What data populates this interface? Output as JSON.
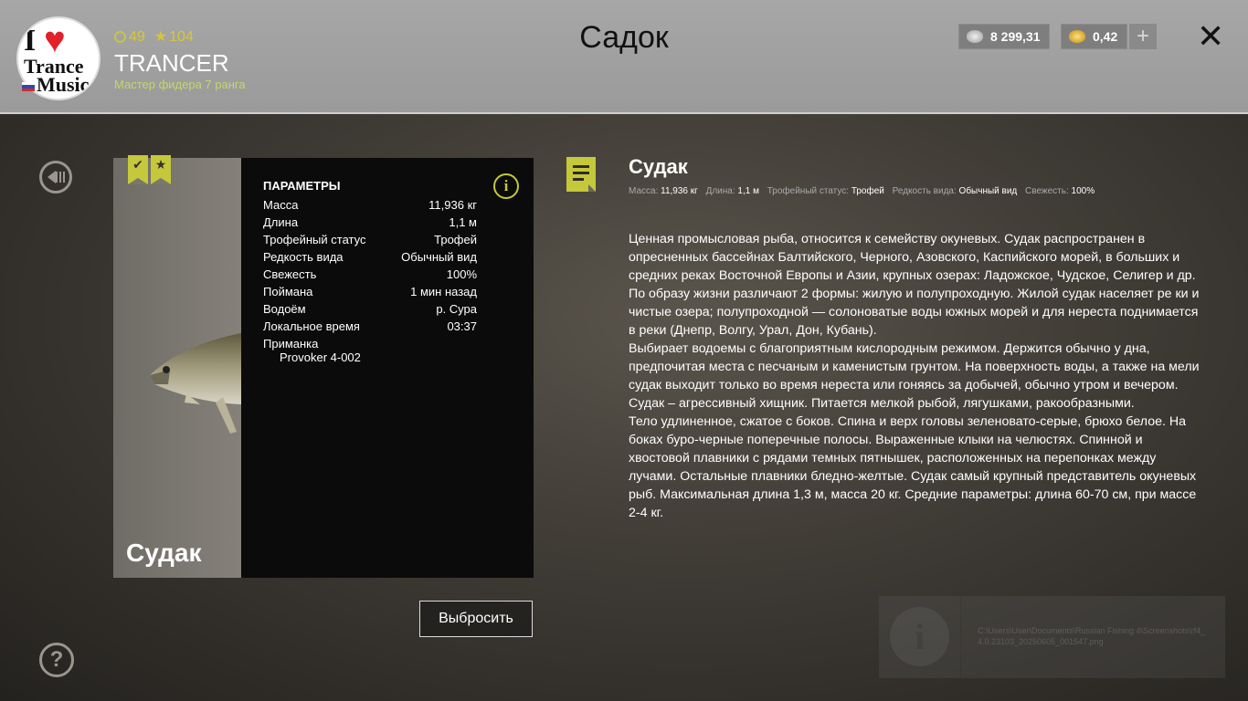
{
  "header": {
    "title": "Садок",
    "level": "49",
    "stars": "104",
    "username": "TRANCER",
    "rank": "Мастер фидера 7 ранга",
    "avatar_text": [
      "I",
      "Trance",
      "Music"
    ],
    "silver": "8 299,31",
    "gold": "0,42",
    "plus_label": "+",
    "close_label": "✕",
    "colors": {
      "silver": "#c9c9c9",
      "gold": "#e4b21e",
      "accent": "#c5c83a"
    }
  },
  "card": {
    "fish_name": "Судак",
    "params_title": "ПАРАМЕТРЫ",
    "params": [
      {
        "label": "Масса",
        "value": "11,936 кг"
      },
      {
        "label": "Длина",
        "value": "1,1 м"
      },
      {
        "label": "Трофейный статус",
        "value": "Трофей"
      },
      {
        "label": "Редкость вида",
        "value": "Обычный вид"
      },
      {
        "label": "Свежесть",
        "value": "100%"
      },
      {
        "label": "Поймана",
        "value": "1 мин назад"
      },
      {
        "label": "Водоём",
        "value": "р. Сура"
      },
      {
        "label": "Локальное время",
        "value": "03:37"
      }
    ],
    "bait_label": "Приманка",
    "bait_value": "Provoker 4-002",
    "throw_button": "Выбросить",
    "info_glyph": "i",
    "badges": [
      "check-badge-icon",
      "star-badge-icon"
    ]
  },
  "description": {
    "title": "Судак",
    "meta": [
      {
        "label": "Масса:",
        "value": "11,936 кг"
      },
      {
        "label": "Длина:",
        "value": "1,1 м"
      },
      {
        "label": "Трофейный статус:",
        "value": "Трофей"
      },
      {
        "label": "Редкость вида:",
        "value": "Обычный вид"
      },
      {
        "label": "Свежесть:",
        "value": "100%"
      }
    ],
    "paragraphs": [
      "Ценная промысловая рыба, относится к семейству окуневых. Судак распространен в опресненных бассейнах Балтийского, Черного, Азовского, Каспийского морей, в больших и средних реках Восточной Европы и Азии, крупных озерах: Ладожское, Чудское, Селигер и др.",
      "По образу жизни различают 2 формы: жилую и полупроходную. Жилой судак населяет ре ки и  чистые озера; полупроходной — солоноватые воды южных морей и для нереста поднимается в реки (Днепр, Волгу, Урал, Дон, Кубань).",
      "Выбирает водоемы с благоприятным кислородным режимом. Держится обычно у дна, предпочитая места с песчаным и каменистым грунтом. На поверхность воды, а также на мели судак выходит только во время нереста или гоняясь за добычей, обычно утром и вечером. Судак – агрессивный хищник. Питается мелкой рыбой, лягушками, ракообразными.",
      " Тело удлиненное, сжатое с боков. Спина и верх головы зеленовато-серые, брюхо белое. На боках буро-черные поперечные полосы. Выраженные клыки на челюстях. Спинной и хвостовой плавники с рядами темных пятнышек, расположенных на перепонках между лучами. Остальные плавники бледно-желтые. Судак самый крупный представитель окуневых рыб. Максимальная длина 1,3 м, масса 20 кг. Средние параметры: длина 60-70 см, при массе 2-4 кг."
    ]
  },
  "side": {
    "help_label": "?"
  },
  "toast": {
    "glyph": "i",
    "text": "C:\\Users\\User\\Documents\\Russian Fishing 4\\Screenshots\\rf4_4.0.23103_20250605_001547.png"
  }
}
